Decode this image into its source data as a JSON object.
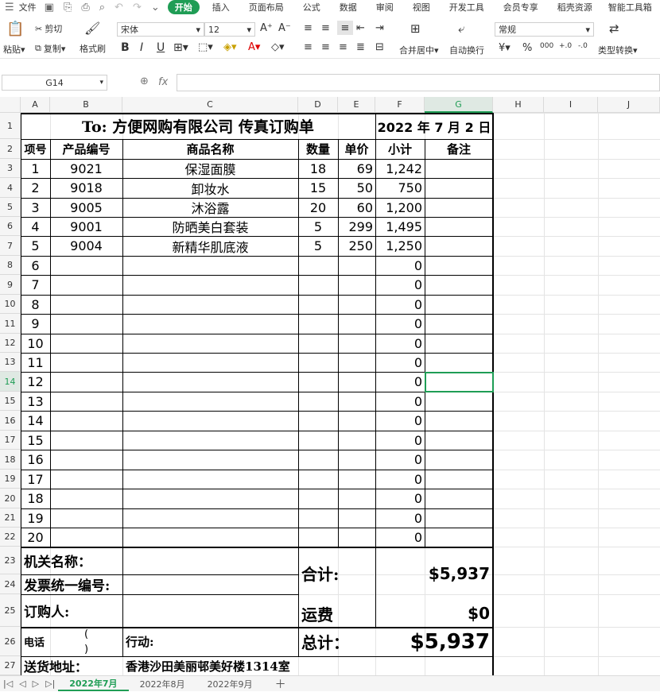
{
  "menubar": {
    "file": "文件",
    "tabs": [
      "开始",
      "插入",
      "页面布局",
      "公式",
      "数据",
      "审阅",
      "视图",
      "开发工具",
      "会员专享",
      "稻壳资源",
      "智能工具箱"
    ]
  },
  "ribbon": {
    "paste": "粘贴",
    "cut": "剪切",
    "copy": "复制",
    "format_painter": "格式刷",
    "font_name": "宋体",
    "font_size": "12",
    "merge_center": "合并居中",
    "wrap_text": "自动换行",
    "number_format": "常规",
    "type_convert": "类型转换"
  },
  "formula_bar": {
    "cell_ref": "G14",
    "fx": "fx",
    "formula": ""
  },
  "columns": [
    "A",
    "B",
    "C",
    "D",
    "E",
    "F",
    "G",
    "H",
    "I",
    "J"
  ],
  "rows": [
    "1",
    "2",
    "3",
    "4",
    "5",
    "6",
    "7",
    "8",
    "9",
    "10",
    "11",
    "12",
    "13",
    "14",
    "15",
    "16",
    "17",
    "18",
    "19",
    "20",
    "21",
    "22",
    "23",
    "24",
    "25",
    "26",
    "27"
  ],
  "sheet": {
    "title": "To: 方便网购有限公司  传真订购单",
    "date": "2022 年 7 月 2  日",
    "headers": {
      "item": "项号",
      "code": "产品编号",
      "name": "商品名称",
      "qty": "数量",
      "price": "单价",
      "subtotal": "小计",
      "remark": "备注"
    },
    "items": [
      {
        "no": "1",
        "code": "9021",
        "name": "保湿面膜",
        "qty": "18",
        "price": "69",
        "subtotal": "1,242"
      },
      {
        "no": "2",
        "code": "9018",
        "name": "卸妆水",
        "qty": "15",
        "price": "50",
        "subtotal": "750"
      },
      {
        "no": "3",
        "code": "9005",
        "name": "沐浴露",
        "qty": "20",
        "price": "60",
        "subtotal": "1,200"
      },
      {
        "no": "4",
        "code": "9001",
        "name": "防晒美白套装",
        "qty": "5",
        "price": "299",
        "subtotal": "1,495"
      },
      {
        "no": "5",
        "code": "9004",
        "name": "新精华肌底液",
        "qty": "5",
        "price": "250",
        "subtotal": "1,250"
      },
      {
        "no": "6",
        "code": "",
        "name": "",
        "qty": "",
        "price": "",
        "subtotal": "0"
      },
      {
        "no": "7",
        "code": "",
        "name": "",
        "qty": "",
        "price": "",
        "subtotal": "0"
      },
      {
        "no": "8",
        "code": "",
        "name": "",
        "qty": "",
        "price": "",
        "subtotal": "0"
      },
      {
        "no": "9",
        "code": "",
        "name": "",
        "qty": "",
        "price": "",
        "subtotal": "0"
      },
      {
        "no": "10",
        "code": "",
        "name": "",
        "qty": "",
        "price": "",
        "subtotal": "0"
      },
      {
        "no": "11",
        "code": "",
        "name": "",
        "qty": "",
        "price": "",
        "subtotal": "0"
      },
      {
        "no": "12",
        "code": "",
        "name": "",
        "qty": "",
        "price": "",
        "subtotal": "0"
      },
      {
        "no": "13",
        "code": "",
        "name": "",
        "qty": "",
        "price": "",
        "subtotal": "0"
      },
      {
        "no": "14",
        "code": "",
        "name": "",
        "qty": "",
        "price": "",
        "subtotal": "0"
      },
      {
        "no": "15",
        "code": "",
        "name": "",
        "qty": "",
        "price": "",
        "subtotal": "0"
      },
      {
        "no": "16",
        "code": "",
        "name": "",
        "qty": "",
        "price": "",
        "subtotal": "0"
      },
      {
        "no": "17",
        "code": "",
        "name": "",
        "qty": "",
        "price": "",
        "subtotal": "0"
      },
      {
        "no": "18",
        "code": "",
        "name": "",
        "qty": "",
        "price": "",
        "subtotal": "0"
      },
      {
        "no": "19",
        "code": "",
        "name": "",
        "qty": "",
        "price": "",
        "subtotal": "0"
      },
      {
        "no": "20",
        "code": "",
        "name": "",
        "qty": "",
        "price": "",
        "subtotal": "0"
      }
    ],
    "footer": {
      "org_label": "机关名称：",
      "invoice_label": "发票统一编号:",
      "buyer_label": "订购人:",
      "phone_label": "电话",
      "paren_open": "(",
      "paren_close": ")",
      "mobile_label": "行动:",
      "address_label": "送货地址：",
      "address_value": "香港沙田美丽邨美好楼1314室",
      "total_label": "合计:",
      "total_value": "$5,937",
      "shipping_label": "运费",
      "shipping_value": "$0",
      "grand_label": "总计：",
      "grand_value": "$5,937"
    }
  },
  "sheet_tabs": [
    "2022年7月",
    "2022年8月",
    "2022年9月"
  ],
  "colors": {
    "accent": "#1f9d55",
    "selection": "#1f9d55"
  }
}
